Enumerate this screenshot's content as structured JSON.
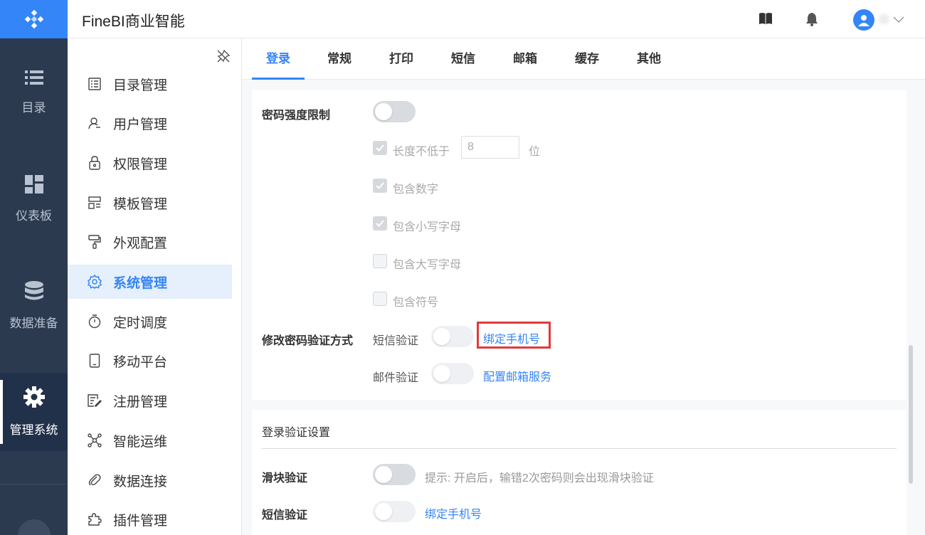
{
  "app": {
    "title": "FineBI商业智能"
  },
  "rail": {
    "items": [
      {
        "label": "目录",
        "icon": "list-icon"
      },
      {
        "label": "仪表板",
        "icon": "dashboard-icon"
      },
      {
        "label": "数据准备",
        "icon": "database-icon"
      },
      {
        "label": "管理系统",
        "icon": "gear-icon",
        "active": true
      }
    ]
  },
  "menu": {
    "items": [
      {
        "label": "目录管理",
        "icon": "catalog-icon"
      },
      {
        "label": "用户管理",
        "icon": "user-icon"
      },
      {
        "label": "权限管理",
        "icon": "lock-icon"
      },
      {
        "label": "模板管理",
        "icon": "template-icon"
      },
      {
        "label": "外观配置",
        "icon": "brush-icon"
      },
      {
        "label": "系统管理",
        "icon": "gear-icon",
        "active": true
      },
      {
        "label": "定时调度",
        "icon": "timer-icon"
      },
      {
        "label": "移动平台",
        "icon": "mobile-icon"
      },
      {
        "label": "注册管理",
        "icon": "register-icon"
      },
      {
        "label": "智能运维",
        "icon": "ops-icon"
      },
      {
        "label": "数据连接",
        "icon": "link-icon"
      },
      {
        "label": "插件管理",
        "icon": "plugin-icon"
      }
    ]
  },
  "tabs": [
    "登录",
    "常规",
    "打印",
    "短信",
    "邮箱",
    "缓存",
    "其他"
  ],
  "password": {
    "strength_label": "密码强度限制",
    "min_length_label": "长度不低于",
    "min_length_value": "8",
    "min_length_unit": "位",
    "rules": [
      {
        "label": "包含数字",
        "checked": true
      },
      {
        "label": "包含小写字母",
        "checked": true
      },
      {
        "label": "包含大写字母",
        "checked": false
      },
      {
        "label": "包含符号",
        "checked": false
      }
    ],
    "change_verify_label": "修改密码验证方式",
    "sms_label": "短信验证",
    "sms_link": "绑定手机号",
    "email_label": "邮件验证",
    "email_link": "配置邮箱服务"
  },
  "login_verify": {
    "section_title": "登录验证设置",
    "slider_label": "滑块验证",
    "slider_hint": "提示: 开启后，输错2次密码则会出现滑块验证",
    "sms_label": "短信验证",
    "sms_link": "绑定手机号"
  },
  "colors": {
    "accent": "#3485f7",
    "rail_bg": "#2b3a4f",
    "highlight": "#e23a3a"
  }
}
